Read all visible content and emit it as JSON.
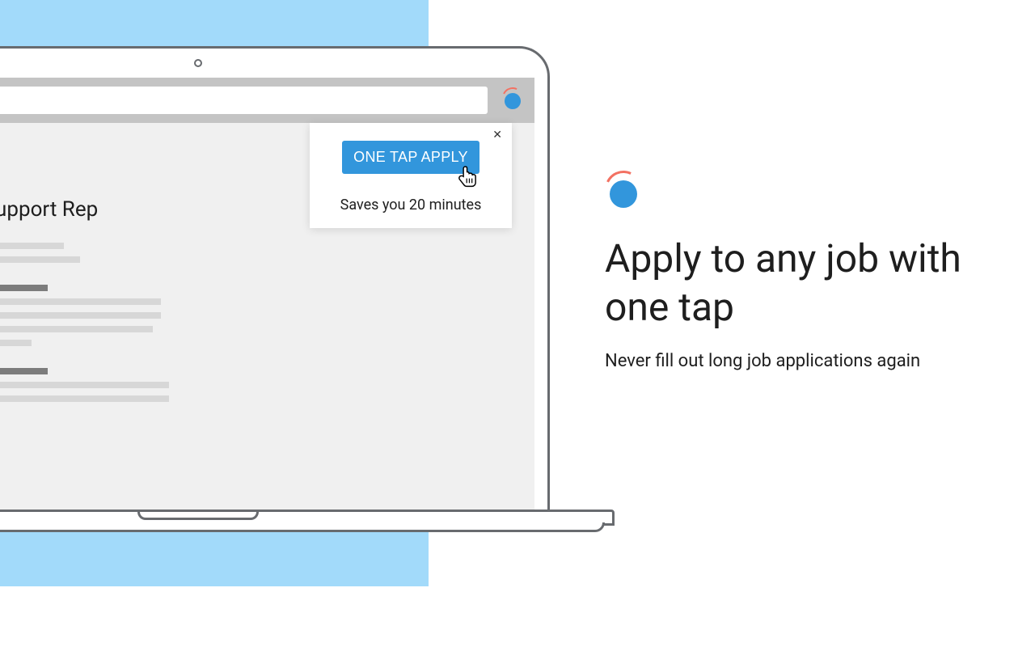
{
  "job": {
    "title": "Customer Support Rep"
  },
  "popup": {
    "button_label": "ONE TAP APPLY",
    "subtext": "Saves you 20 minutes",
    "close_glyph": "✕"
  },
  "copy": {
    "headline": "Apply to any job with one tap",
    "subheadline": "Never fill out long job applications again"
  }
}
